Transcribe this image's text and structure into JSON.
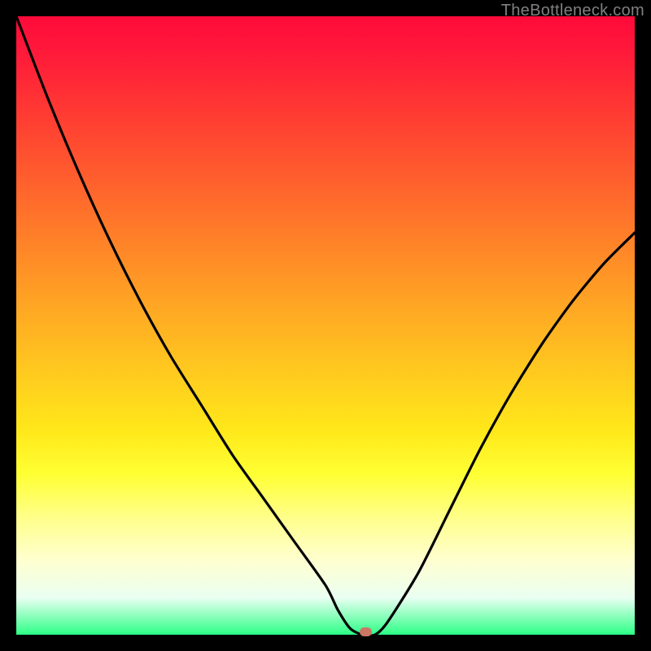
{
  "watermark": "TheBottleneck.com",
  "chart_data": {
    "type": "line",
    "title": "",
    "xlabel": "",
    "ylabel": "",
    "xlim": [
      0,
      100
    ],
    "ylim": [
      0,
      100
    ],
    "grid": false,
    "legend": false,
    "series": [
      {
        "name": "curve",
        "color": "#000000",
        "x": [
          0,
          5,
          10,
          15,
          20,
          25,
          30,
          35,
          40,
          45,
          50,
          52,
          54,
          56,
          58,
          60,
          65,
          70,
          75,
          80,
          85,
          90,
          95,
          100
        ],
        "y": [
          100,
          87,
          75,
          64,
          54,
          45,
          37,
          29,
          22,
          15,
          8,
          4,
          1,
          0,
          0,
          2,
          10,
          20,
          30,
          39,
          47,
          54,
          60,
          65
        ]
      }
    ],
    "marker": {
      "x": 56.5,
      "y": 0.5,
      "color": "#cc7766"
    },
    "background_gradient": {
      "top": "#ff0a3a",
      "mid_upper": "#ff7d29",
      "mid": "#ffe81a",
      "mid_lower": "#ffffd0",
      "bottom": "#2cff85"
    }
  }
}
